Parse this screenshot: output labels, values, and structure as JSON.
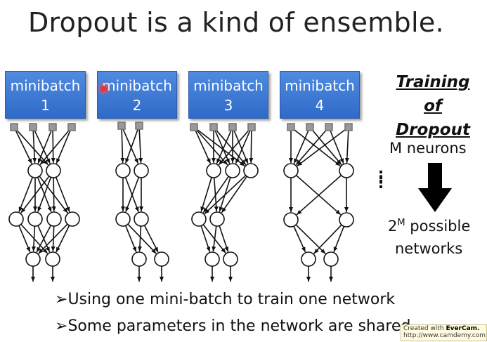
{
  "slide": {
    "title": "Dropout is a kind of ensemble.",
    "minibatches": [
      {
        "label": "minibatch",
        "number": "1"
      },
      {
        "label": "minibatch",
        "number": "2"
      },
      {
        "label": "minibatch",
        "number": "3"
      },
      {
        "label": "minibatch",
        "number": "4"
      }
    ],
    "side_heading_line1": "Training of",
    "side_heading_line2": "Dropout",
    "neurons_text": "M neurons",
    "possible_base": "2",
    "possible_sup": "M",
    "possible_rest": " possible",
    "networks_text": "networks",
    "ellipsis": "……",
    "bullets": [
      "Using one mini-batch to train one network",
      "Some parameters in the network are shared"
    ],
    "bullet_marker": "➢",
    "watermark_line1_prefix": "Created with ",
    "watermark_line1_brand": "EverCam.",
    "watermark_line2": "http://www.camdemy.com"
  },
  "colors": {
    "minibatch_fill": "#3a77d4",
    "arrow_down": "#000000",
    "pointer": "#e33333"
  }
}
